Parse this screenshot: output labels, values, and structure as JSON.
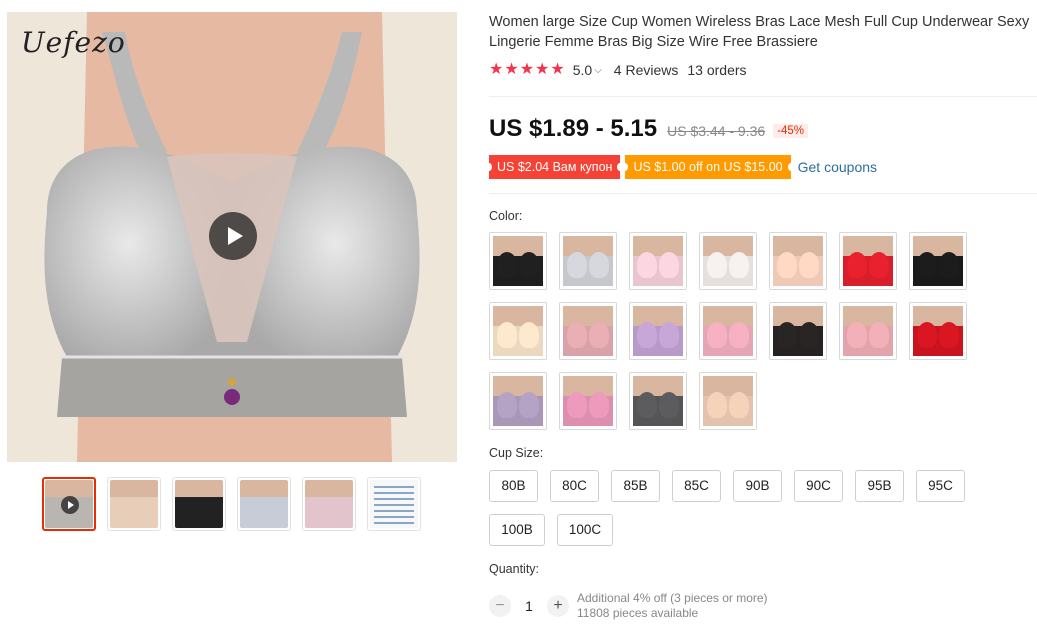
{
  "gallery": {
    "brand_logo": "Uefezo",
    "thumbnails": [
      {
        "name": "gray",
        "color": "#b9b6b2",
        "video": true,
        "active": true
      },
      {
        "name": "beige",
        "color": "#e8cdb8"
      },
      {
        "name": "black",
        "color": "#222222"
      },
      {
        "name": "blue-gray",
        "color": "#c8ccd6"
      },
      {
        "name": "pink",
        "color": "#e3c4cc"
      },
      {
        "name": "size-chart",
        "color": "#f5f7f8",
        "chart": true
      }
    ]
  },
  "product": {
    "title": "Women large Size Cup Women Wireless Bras Lace Mesh Full Cup Underwear Sexy Lingerie Femme Bras Big Size Wire Free Brassiere",
    "rating_value": "5.0",
    "reviews": "4 Reviews",
    "orders": "13 orders",
    "price": "US $1.89 - 5.15",
    "original_price": "US $3.44 - 9.36",
    "discount": "-45%",
    "coupon_1": "US $2.04 Вам купон",
    "coupon_2": "US $1.00 off on US $15.00",
    "get_coupons": "Get coupons",
    "color_label": "Color:",
    "cup_size_label": "Cup Size:",
    "quantity_label": "Quantity:",
    "quantity": "1",
    "additional_off": "Additional 4% off (3 pieces or more)",
    "available": "11808 pieces available",
    "minus": "−",
    "plus": "+"
  },
  "colors": [
    {
      "name": "black",
      "hex": "#1e1e1e"
    },
    {
      "name": "light-gray",
      "hex": "#c7c8cd"
    },
    {
      "name": "light-pink",
      "hex": "#e9c6cf"
    },
    {
      "name": "white",
      "hex": "#e5dfdd"
    },
    {
      "name": "skin",
      "hex": "#eec9b5"
    },
    {
      "name": "red",
      "hex": "#d81e2a"
    },
    {
      "name": "black-2",
      "hex": "#1a1a1a"
    },
    {
      "name": "beige",
      "hex": "#ead8bf"
    },
    {
      "name": "rose",
      "hex": "#d8a2a8"
    },
    {
      "name": "lavender",
      "hex": "#b89ac8"
    },
    {
      "name": "pink",
      "hex": "#e4a5b4"
    },
    {
      "name": "black-lace",
      "hex": "#262222"
    },
    {
      "name": "pink-lace",
      "hex": "#e2a3aa"
    },
    {
      "name": "red-lace",
      "hex": "#c9141f"
    },
    {
      "name": "purple-gray",
      "hex": "#a897b6"
    },
    {
      "name": "hot-pink",
      "hex": "#dc8fae"
    },
    {
      "name": "dark-gray",
      "hex": "#555558"
    },
    {
      "name": "nude",
      "hex": "#e3c3ad"
    }
  ],
  "cup_sizes": [
    "80B",
    "80C",
    "85B",
    "85C",
    "90B",
    "90C",
    "95B",
    "95C",
    "100B",
    "100C"
  ],
  "theme": {
    "accent": "#e62e04",
    "star": "#f5334c",
    "coupon_red": "#f44336",
    "coupon_orange": "#ff9a00",
    "link": "#2e6e9e"
  }
}
